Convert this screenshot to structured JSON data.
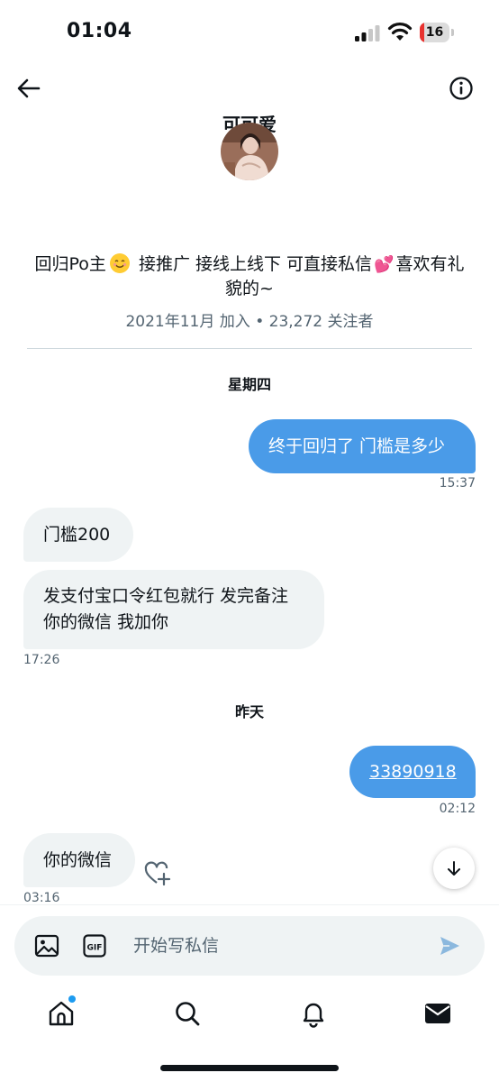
{
  "status_bar": {
    "time": "01:04",
    "battery": "16",
    "battery_level": 0.16,
    "battery_color": "#e8322f"
  },
  "header": {
    "title": "可可爱"
  },
  "profile": {
    "bio_part1": "回归Po主",
    "bio_part2": "接推广 接线上线下 可直接私信",
    "bio_part3": "喜欢有礼貌的~",
    "emoji_1": "smiling-face",
    "emoji_2": "💕",
    "joined": "2021年11月 加入",
    "separator": "•",
    "followers": "23,272 关注者"
  },
  "messages": {
    "day_1": "星期四",
    "m1": {
      "text": "终于回归了 门槛是多少",
      "time": "15:37"
    },
    "m2": {
      "text": "门槛200"
    },
    "m3": {
      "line1": "发支付宝口令红包就行 发完备注",
      "line2": "你的微信 我加你",
      "time": "17:26"
    },
    "day_2": "昨天",
    "m4": {
      "text": "33890918",
      "time": "02:12"
    },
    "m5": {
      "text": "你的微信",
      "time": "03:16"
    }
  },
  "composer": {
    "placeholder": "开始写私信"
  },
  "colors": {
    "accent": "#1d9bf0",
    "outgoing_bubble": "#4a9be8",
    "incoming_bubble": "#eff3f4"
  }
}
